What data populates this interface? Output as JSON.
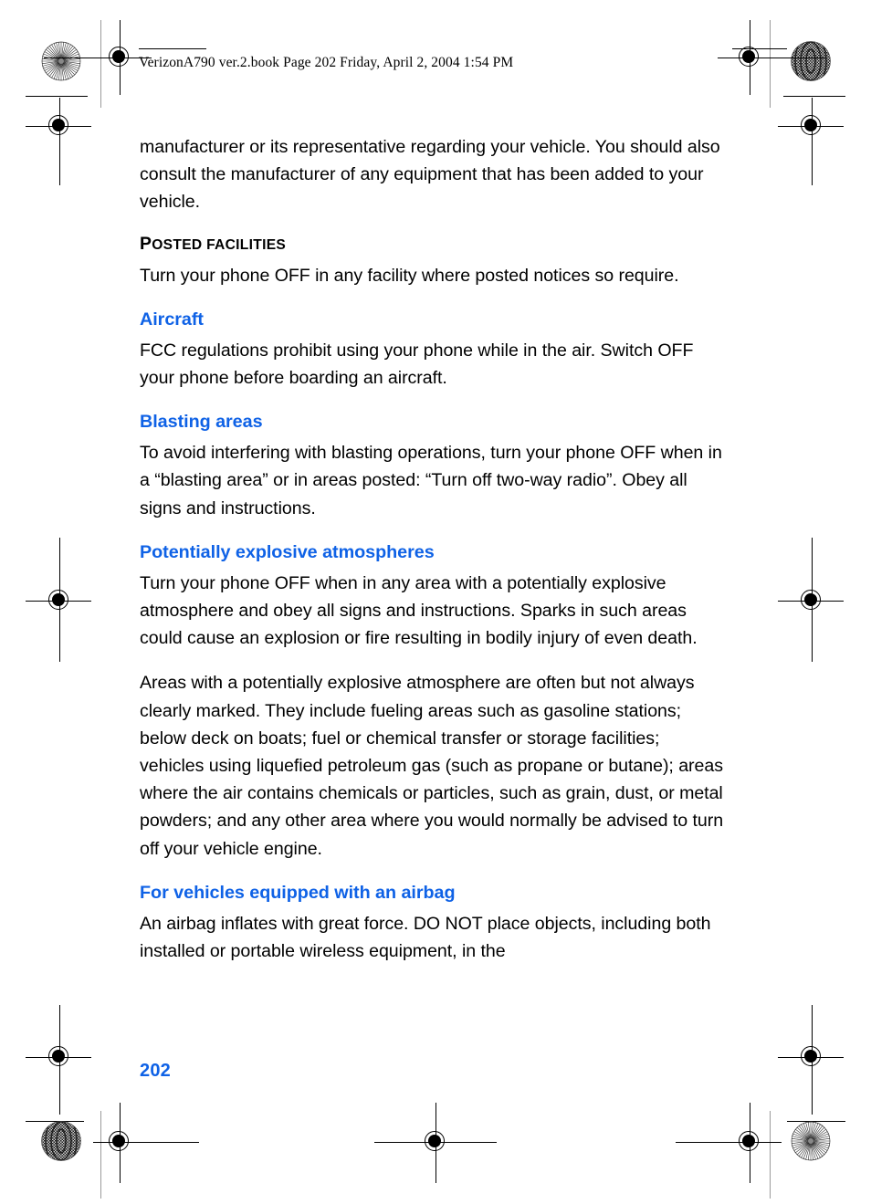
{
  "document": {
    "header": "VerizonA790 ver.2.book  Page 202  Friday, April 2, 2004  1:54 PM",
    "page_number": "202",
    "accent_color": "#0f62e6",
    "text_color": "#000000",
    "background_color": "#ffffff"
  },
  "content": {
    "intro_paragraph": "manufacturer or its representative regarding your vehicle. You should also consult the manufacturer of any equipment that has been added to your vehicle.",
    "posted_facilities": {
      "heading_first_letter": "P",
      "heading_rest": "OSTED FACILITIES",
      "paragraph": "Turn your phone OFF in any facility where posted notices so require."
    },
    "aircraft": {
      "heading": "Aircraft",
      "paragraph": "FCC regulations prohibit using your phone while in the air. Switch OFF your phone before boarding an aircraft."
    },
    "blasting_areas": {
      "heading": "Blasting areas",
      "paragraph": "To avoid interfering with blasting operations, turn your phone OFF when in a “blasting area” or in areas posted: “Turn off two-way radio”. Obey all signs and instructions."
    },
    "potentially_explosive": {
      "heading": "Potentially explosive atmospheres",
      "paragraph_1": "Turn your phone OFF when in any area with a potentially explosive atmosphere and obey all signs and instructions. Sparks in such areas could cause an explosion or fire resulting in bodily injury of even death.",
      "paragraph_2": "Areas with a potentially explosive atmosphere are often but not always clearly marked. They include fueling areas such as gasoline stations; below deck on boats; fuel or chemical transfer or storage facilities; vehicles using liquefied petroleum gas (such as propane or butane); areas where the air contains chemicals or particles, such as grain, dust, or metal powders; and any other area where you would normally be advised to turn off your vehicle engine."
    },
    "airbag": {
      "heading": "For vehicles equipped with an airbag",
      "paragraph": "An airbag inflates with great force. DO NOT place objects, including both installed or portable wireless equipment, in the"
    }
  },
  "print_marks": {
    "registration_icon": "registration-target-icon",
    "starburst_icon": "starburst-print-mark-icon",
    "moire_icon": "moire-print-mark-icon"
  }
}
